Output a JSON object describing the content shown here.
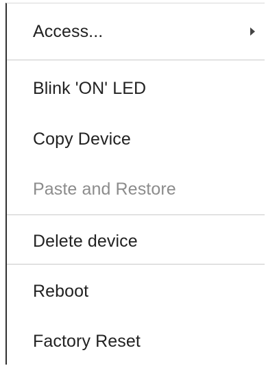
{
  "menu": {
    "items": [
      {
        "label": "Access...",
        "has_submenu": true,
        "enabled": true
      },
      {
        "label": "Blink 'ON' LED",
        "enabled": true
      },
      {
        "label": "Copy Device",
        "enabled": true
      },
      {
        "label": "Paste and Restore",
        "enabled": false
      },
      {
        "label": "Delete device",
        "enabled": true
      },
      {
        "label": "Reboot",
        "enabled": true
      },
      {
        "label": "Factory Reset",
        "enabled": true
      }
    ],
    "submenu_icon": "chevron-right-icon",
    "colors": {
      "text": "#222222",
      "disabled_text": "#8c8c8c",
      "separator": "#c9c9c9"
    }
  }
}
